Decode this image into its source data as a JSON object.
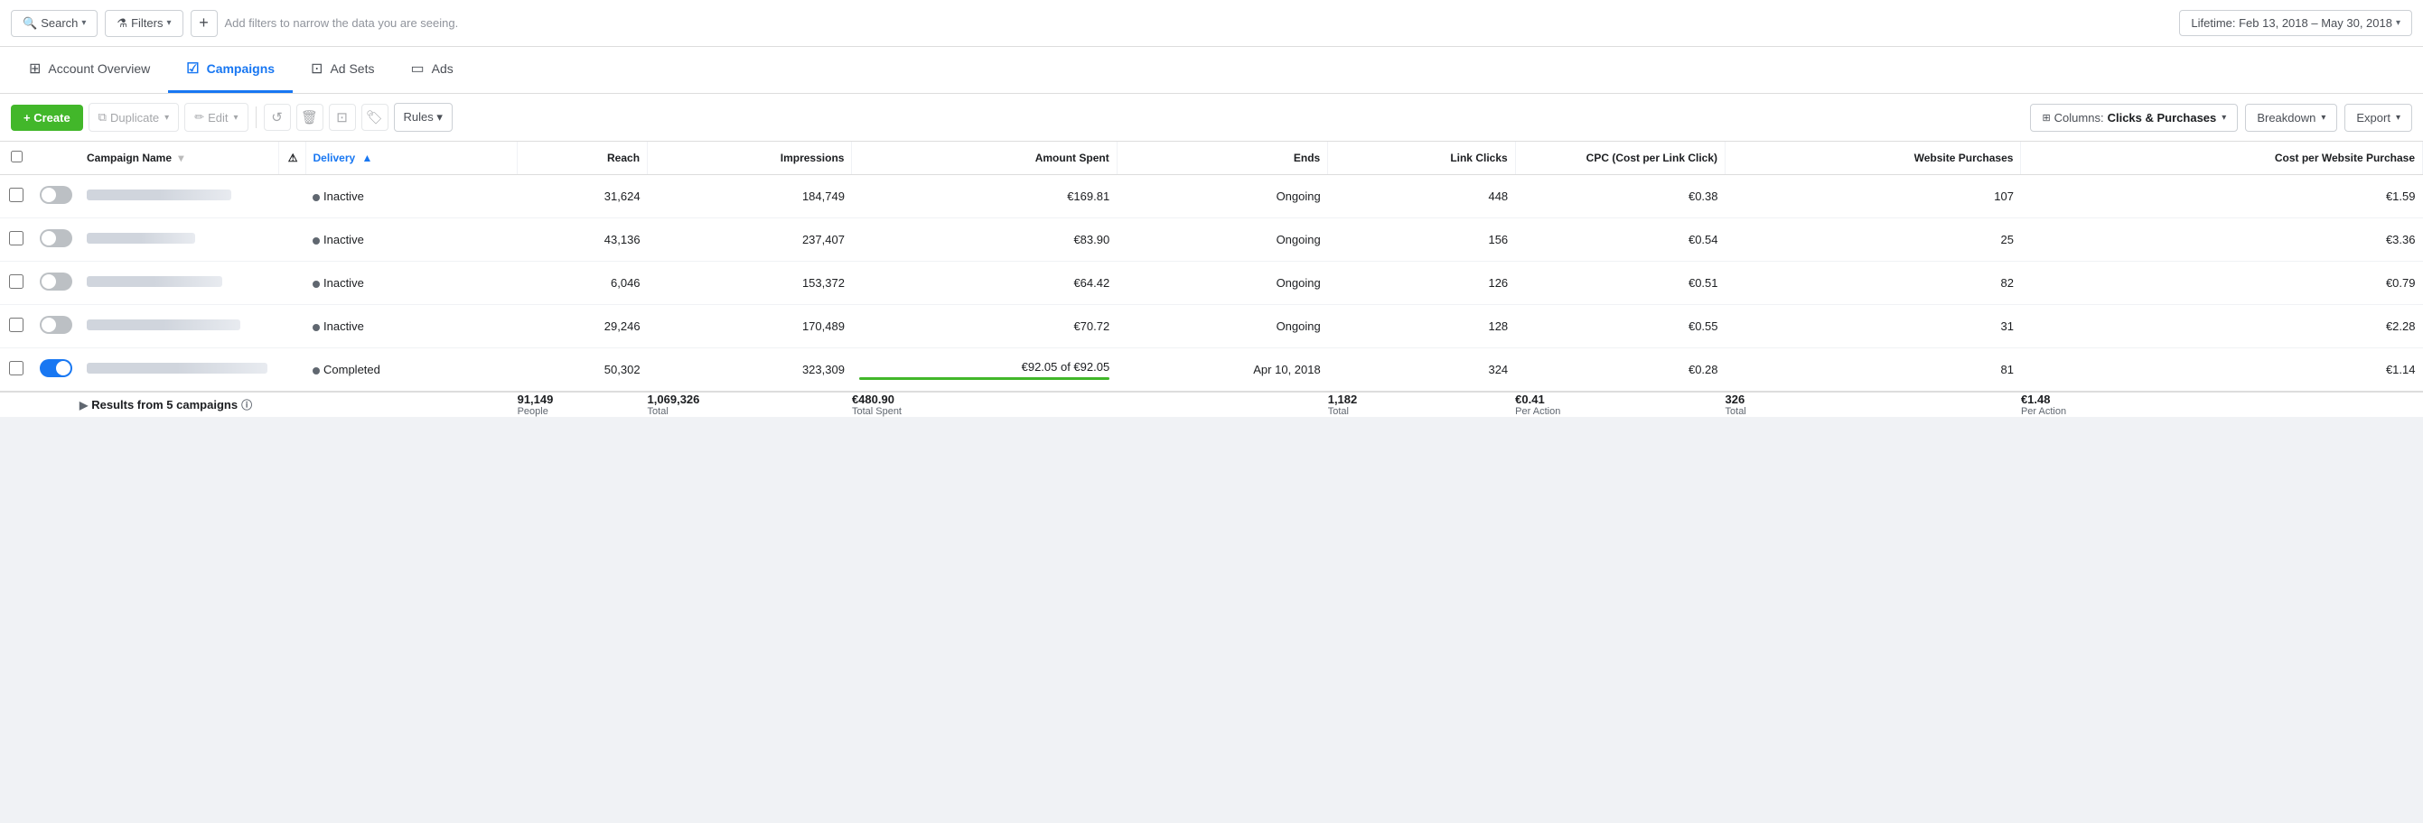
{
  "filterBar": {
    "searchLabel": "Search",
    "filtersLabel": "Filters",
    "addTitle": "+",
    "hint": "Add filters to narrow the data you are seeing.",
    "dateRange": "Lifetime: Feb 13, 2018 – May 30, 2018"
  },
  "navTabs": [
    {
      "id": "account-overview",
      "label": "Account Overview",
      "active": false,
      "icon": "grid-icon"
    },
    {
      "id": "campaigns",
      "label": "Campaigns",
      "active": true,
      "icon": "check-icon"
    },
    {
      "id": "ad-sets",
      "label": "Ad Sets",
      "active": false,
      "icon": "adsets-icon"
    },
    {
      "id": "ads",
      "label": "Ads",
      "active": false,
      "icon": "ads-icon"
    }
  ],
  "toolbar": {
    "createLabel": "+ Create",
    "duplicateLabel": "Duplicate",
    "editLabel": "Edit",
    "rulesLabel": "Rules ▾",
    "columnsLabel": "Columns: ",
    "columnsValue": "Clicks & Purchases",
    "breakdownLabel": "Breakdown",
    "exportLabel": "Export"
  },
  "tableHeaders": [
    {
      "id": "checkbox",
      "label": ""
    },
    {
      "id": "toggle",
      "label": ""
    },
    {
      "id": "campaign-name",
      "label": "Campaign Name",
      "sortable": true
    },
    {
      "id": "warning",
      "label": ""
    },
    {
      "id": "delivery",
      "label": "Delivery",
      "sortActive": true,
      "sortDir": "asc"
    },
    {
      "id": "reach",
      "label": "Reach"
    },
    {
      "id": "impressions",
      "label": "Impressions"
    },
    {
      "id": "amount-spent",
      "label": "Amount Spent"
    },
    {
      "id": "ends",
      "label": "Ends"
    },
    {
      "id": "link-clicks",
      "label": "Link Clicks"
    },
    {
      "id": "cpc",
      "label": "CPC (Cost per Link Click)"
    },
    {
      "id": "website-purchases",
      "label": "Website Purchases"
    },
    {
      "id": "cost-per-website-purchase",
      "label": "Cost per Website Purchase"
    }
  ],
  "campaigns": [
    {
      "id": 1,
      "toggleState": "off",
      "nameWidth": 160,
      "delivery": "Inactive",
      "deliveryStatus": "inactive",
      "reach": "31,624",
      "impressions": "184,749",
      "amountSpent": "€169.81",
      "amountProgress": null,
      "ends": "Ongoing",
      "linkClicks": "448",
      "cpc": "€0.38",
      "websitePurchases": "107",
      "costPerWebsitePurchase": "€1.59"
    },
    {
      "id": 2,
      "toggleState": "off",
      "nameWidth": 120,
      "delivery": "Inactive",
      "deliveryStatus": "inactive",
      "reach": "43,136",
      "impressions": "237,407",
      "amountSpent": "€83.90",
      "amountProgress": null,
      "ends": "Ongoing",
      "linkClicks": "156",
      "cpc": "€0.54",
      "websitePurchases": "25",
      "costPerWebsitePurchase": "€3.36"
    },
    {
      "id": 3,
      "toggleState": "off",
      "nameWidth": 150,
      "delivery": "Inactive",
      "deliveryStatus": "inactive",
      "reach": "6,046",
      "impressions": "153,372",
      "amountSpent": "€64.42",
      "amountProgress": null,
      "ends": "Ongoing",
      "linkClicks": "126",
      "cpc": "€0.51",
      "websitePurchases": "82",
      "costPerWebsitePurchase": "€0.79"
    },
    {
      "id": 4,
      "toggleState": "off",
      "nameWidth": 170,
      "delivery": "Inactive",
      "deliveryStatus": "inactive",
      "reach": "29,246",
      "impressions": "170,489",
      "amountSpent": "€70.72",
      "amountProgress": null,
      "ends": "Ongoing",
      "linkClicks": "128",
      "cpc": "€0.55",
      "websitePurchases": "31",
      "costPerWebsitePurchase": "€2.28"
    },
    {
      "id": 5,
      "toggleState": "on",
      "nameWidth": 200,
      "delivery": "Completed",
      "deliveryStatus": "completed",
      "reach": "50,302",
      "impressions": "323,309",
      "amountSpent": "€92.05",
      "amountSpentDetail": "€92.05 of €92.05",
      "amountProgress": 100,
      "ends": "Apr 10, 2018",
      "linkClicks": "324",
      "cpc": "€0.28",
      "websitePurchases": "81",
      "costPerWebsitePurchase": "€1.14"
    }
  ],
  "summary": {
    "label": "Results from 5 campaigns",
    "reach": "91,149",
    "reachSub": "People",
    "impressions": "1,069,326",
    "impressionsSub": "Total",
    "amountSpent": "€480.90",
    "amountSpentSub": "Total Spent",
    "ends": "",
    "linkClicks": "1,182",
    "linkClicksSub": "Total",
    "cpc": "€0.41",
    "cpcSub": "Per Action",
    "websitePurchases": "326",
    "websitePurchasesSub": "Total",
    "costPerWebsitePurchase": "€1.48",
    "costPerWebsitePurchaseSub": "Per Action"
  }
}
